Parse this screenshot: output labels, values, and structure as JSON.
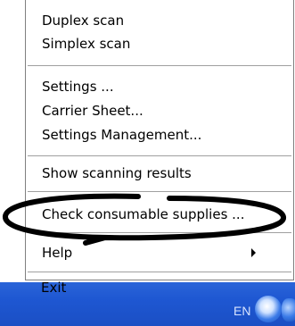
{
  "menu": {
    "items": [
      {
        "label": "Duplex scan"
      },
      {
        "label": "Simplex scan"
      },
      {
        "label": "Settings ..."
      },
      {
        "label": "Carrier Sheet..."
      },
      {
        "label": "Settings Management..."
      },
      {
        "label": "Show scanning results"
      },
      {
        "label": "Check consumable supplies ..."
      },
      {
        "label": "Help"
      },
      {
        "label": "Exit"
      }
    ]
  },
  "taskbar": {
    "language": "EN"
  },
  "annotation": {
    "color": "#000000"
  }
}
